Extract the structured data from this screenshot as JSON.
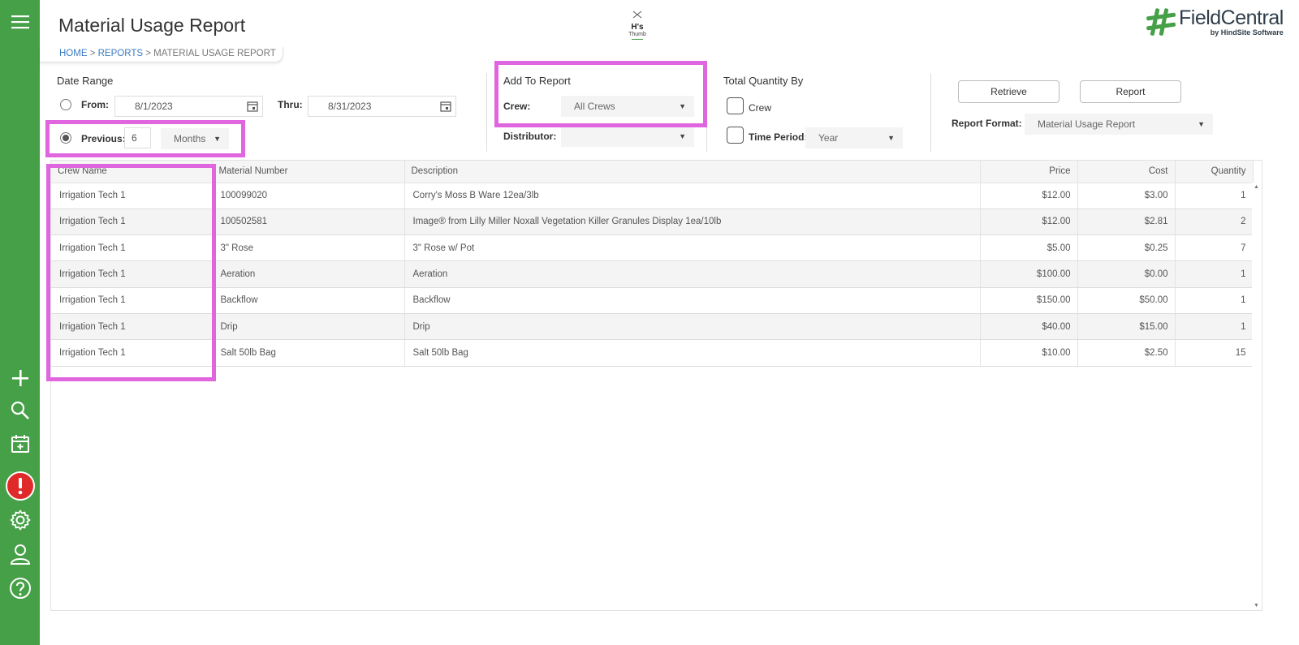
{
  "header": {
    "page_title": "Material Usage Report",
    "center_brand": {
      "name": "H's",
      "sub": "Thumb"
    },
    "logo": {
      "name": "FieldCentral",
      "tagline": "by HindSite Software",
      "color": "#46a047"
    }
  },
  "breadcrumb": {
    "home": "HOME",
    "sep": ">",
    "reports": "REPORTS",
    "current": "MATERIAL USAGE REPORT"
  },
  "sidebar": {
    "color": "#46a047",
    "icons": [
      "menu-icon",
      "add-icon",
      "search-icon",
      "calendar-add-icon",
      "alert-icon",
      "settings-icon",
      "user-icon",
      "help-icon"
    ]
  },
  "date_range": {
    "title": "Date Range",
    "from_label": "From:",
    "from_value": "8/1/2023",
    "thru_label": "Thru:",
    "thru_value": "8/31/2023",
    "previous_label": "Previous:",
    "previous_value": "6",
    "period_unit": "Months"
  },
  "add_to_report": {
    "title": "Add To Report",
    "crew_label": "Crew:",
    "crew_value": "All Crews",
    "distributor_label": "Distributor:",
    "distributor_value": ""
  },
  "total_quantity_by": {
    "title": "Total Quantity By",
    "crew_label": "Crew",
    "time_period_label": "Time Period:",
    "time_period_value": "Year"
  },
  "actions": {
    "retrieve_label": "Retrieve",
    "report_label": "Report",
    "format_label": "Report Format:",
    "format_value": "Material Usage Report"
  },
  "table": {
    "columns": [
      "Crew Name",
      "Material Number",
      "Description",
      "Price",
      "Cost",
      "Quantity"
    ],
    "rows": [
      [
        "Irrigation Tech 1",
        "100099020",
        "Corry's Moss B Ware 12ea/3lb",
        "$12.00",
        "$3.00",
        "1"
      ],
      [
        "Irrigation Tech 1",
        "100502581",
        "Image® from Lilly Miller Noxall Vegetation Killer Granules Display 1ea/10lb",
        "$12.00",
        "$2.81",
        "2"
      ],
      [
        "Irrigation Tech 1",
        "3\" Rose",
        "3\" Rose w/ Pot",
        "$5.00",
        "$0.25",
        "7"
      ],
      [
        "Irrigation Tech 1",
        "Aeration",
        "Aeration",
        "$100.00",
        "$0.00",
        "1"
      ],
      [
        "Irrigation Tech 1",
        "Backflow",
        "Backflow",
        "$150.00",
        "$50.00",
        "1"
      ],
      [
        "Irrigation Tech 1",
        "Drip",
        "Drip",
        "$40.00",
        "$15.00",
        "1"
      ],
      [
        "Irrigation Tech 1",
        "Salt 50lb Bag",
        "Salt 50lb Bag",
        "$10.00",
        "$2.50",
        "15"
      ]
    ]
  },
  "highlight_color": "#e066e0"
}
